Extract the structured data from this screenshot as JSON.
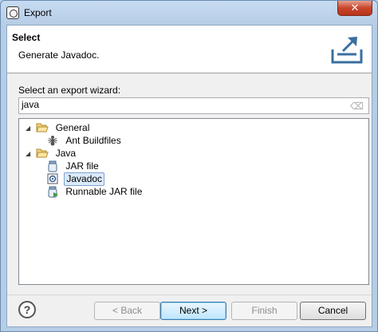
{
  "window": {
    "title": "Export"
  },
  "header": {
    "title": "Select",
    "description": "Generate Javadoc."
  },
  "wizard": {
    "label": "Select an export wizard:",
    "filter_value": "java",
    "tree": [
      {
        "label": "General",
        "expanded": true,
        "children": [
          {
            "label": "Ant Buildfiles"
          }
        ]
      },
      {
        "label": "Java",
        "expanded": true,
        "children": [
          {
            "label": "JAR file"
          },
          {
            "label": "Javadoc",
            "selected": true
          },
          {
            "label": "Runnable JAR file"
          }
        ]
      }
    ]
  },
  "buttons": {
    "back": "< Back",
    "next": "Next >",
    "finish": "Finish",
    "cancel": "Cancel"
  },
  "help": {
    "glyph": "?"
  },
  "colors": {
    "selection": "#dbeafc",
    "close": "#c7452a"
  }
}
